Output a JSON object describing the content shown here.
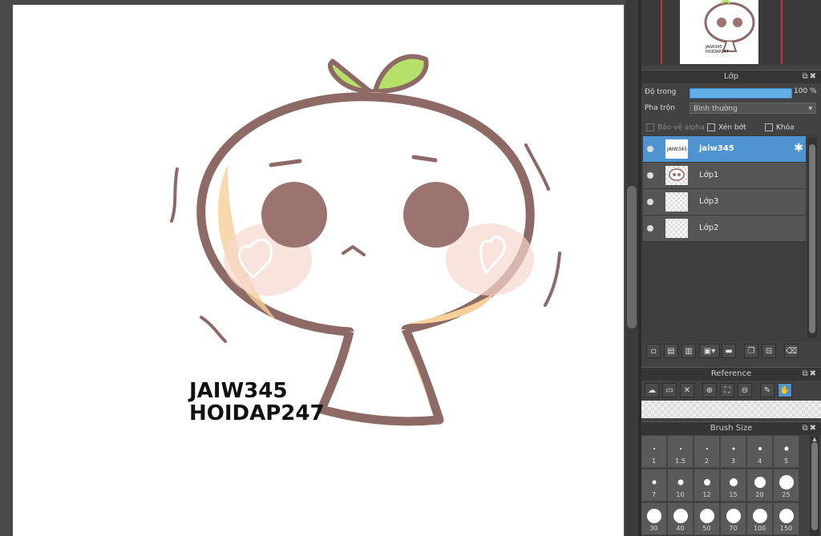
{
  "canvas": {
    "artwork_text_line1": "JAIW345",
    "artwork_text_line2": "HOIDAP247"
  },
  "navigator": {
    "thumb_text_line1": "JAIW345",
    "thumb_text_line2": "HOIDAP247"
  },
  "layer_panel": {
    "title": "Lớp",
    "opacity_label": "Độ trong",
    "opacity_value": "100 %",
    "opacity_percent": 100,
    "blend_label": "Pha trộn",
    "blend_value": "Bình thường",
    "protect_alpha_label": "Bảo vệ alpha",
    "clipping_label": "Xén bớt",
    "lock_label": "Khóa",
    "layers": [
      {
        "name": "jaiw345",
        "active": true
      },
      {
        "name": "Lớp1",
        "active": false
      },
      {
        "name": "Lớp3",
        "active": false
      },
      {
        "name": "Lớp2",
        "active": false
      }
    ],
    "thumb_text": "JAIW345"
  },
  "reference_panel": {
    "title": "Reference"
  },
  "brush_panel": {
    "title": "Brush Size",
    "sizes": [
      "1",
      "1.5",
      "2",
      "3",
      "4",
      "5",
      "7",
      "10",
      "12",
      "15",
      "20",
      "25",
      "30",
      "40",
      "50",
      "70",
      "100",
      "150"
    ]
  },
  "colors": {
    "accent": "#4f94d1",
    "outline": "#8d6a66",
    "leaf": "#b5e06a",
    "skin_shadow": "#f6cf99",
    "blush": "#f7d7cf"
  },
  "icons": {
    "gear": "gear-icon",
    "eye": "eye-icon",
    "hand": "hand-icon",
    "trash": "trash-icon"
  }
}
